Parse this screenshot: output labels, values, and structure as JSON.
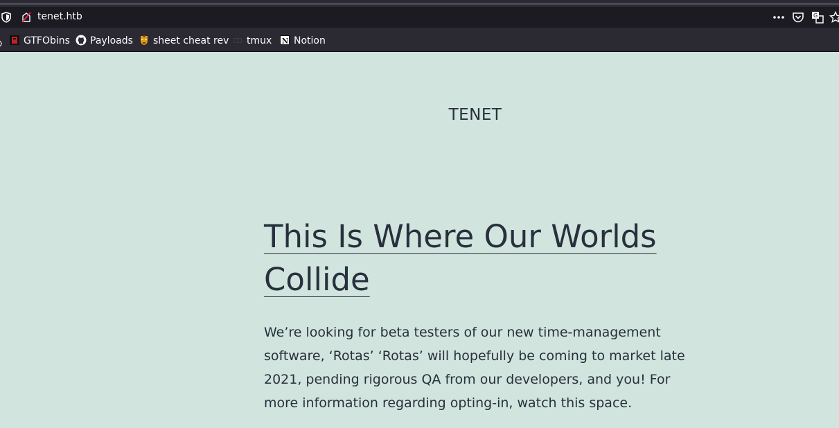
{
  "browser": {
    "url": "tenet.htb",
    "icons": {
      "tracking_protection": "shield-icon",
      "site_icon": "site-identity-icon",
      "page_actions": "more-actions-icon",
      "pocket": "pocket-icon",
      "translate": "translate-icon",
      "bookmark_star": "star-icon"
    }
  },
  "bookmarks": [
    {
      "label": "GTFObins",
      "icon": "gtfobins-icon"
    },
    {
      "label": "Payloads",
      "icon": "github-icon"
    },
    {
      "label": "sheet cheat rev",
      "icon": "ironman-icon"
    },
    {
      "label": "tmux",
      "icon": "tmux-icon"
    },
    {
      "label": "Notion",
      "icon": "notion-icon"
    }
  ],
  "site": {
    "title": "TENET"
  },
  "post": {
    "title": "This Is Where Our Worlds Collide",
    "body": "We’re looking for beta testers of our new time-management software, ‘Rotas’ ‘Rotas’ will hopefully be coming to market late 2021, pending rigorous QA from our developers, and you! For more information regarding opting-in, watch this space."
  },
  "colors": {
    "page_background": "#d1e4dd",
    "text": "#28303d",
    "toolbar": "#2b2a33",
    "urlbar": "#1c1b22"
  }
}
